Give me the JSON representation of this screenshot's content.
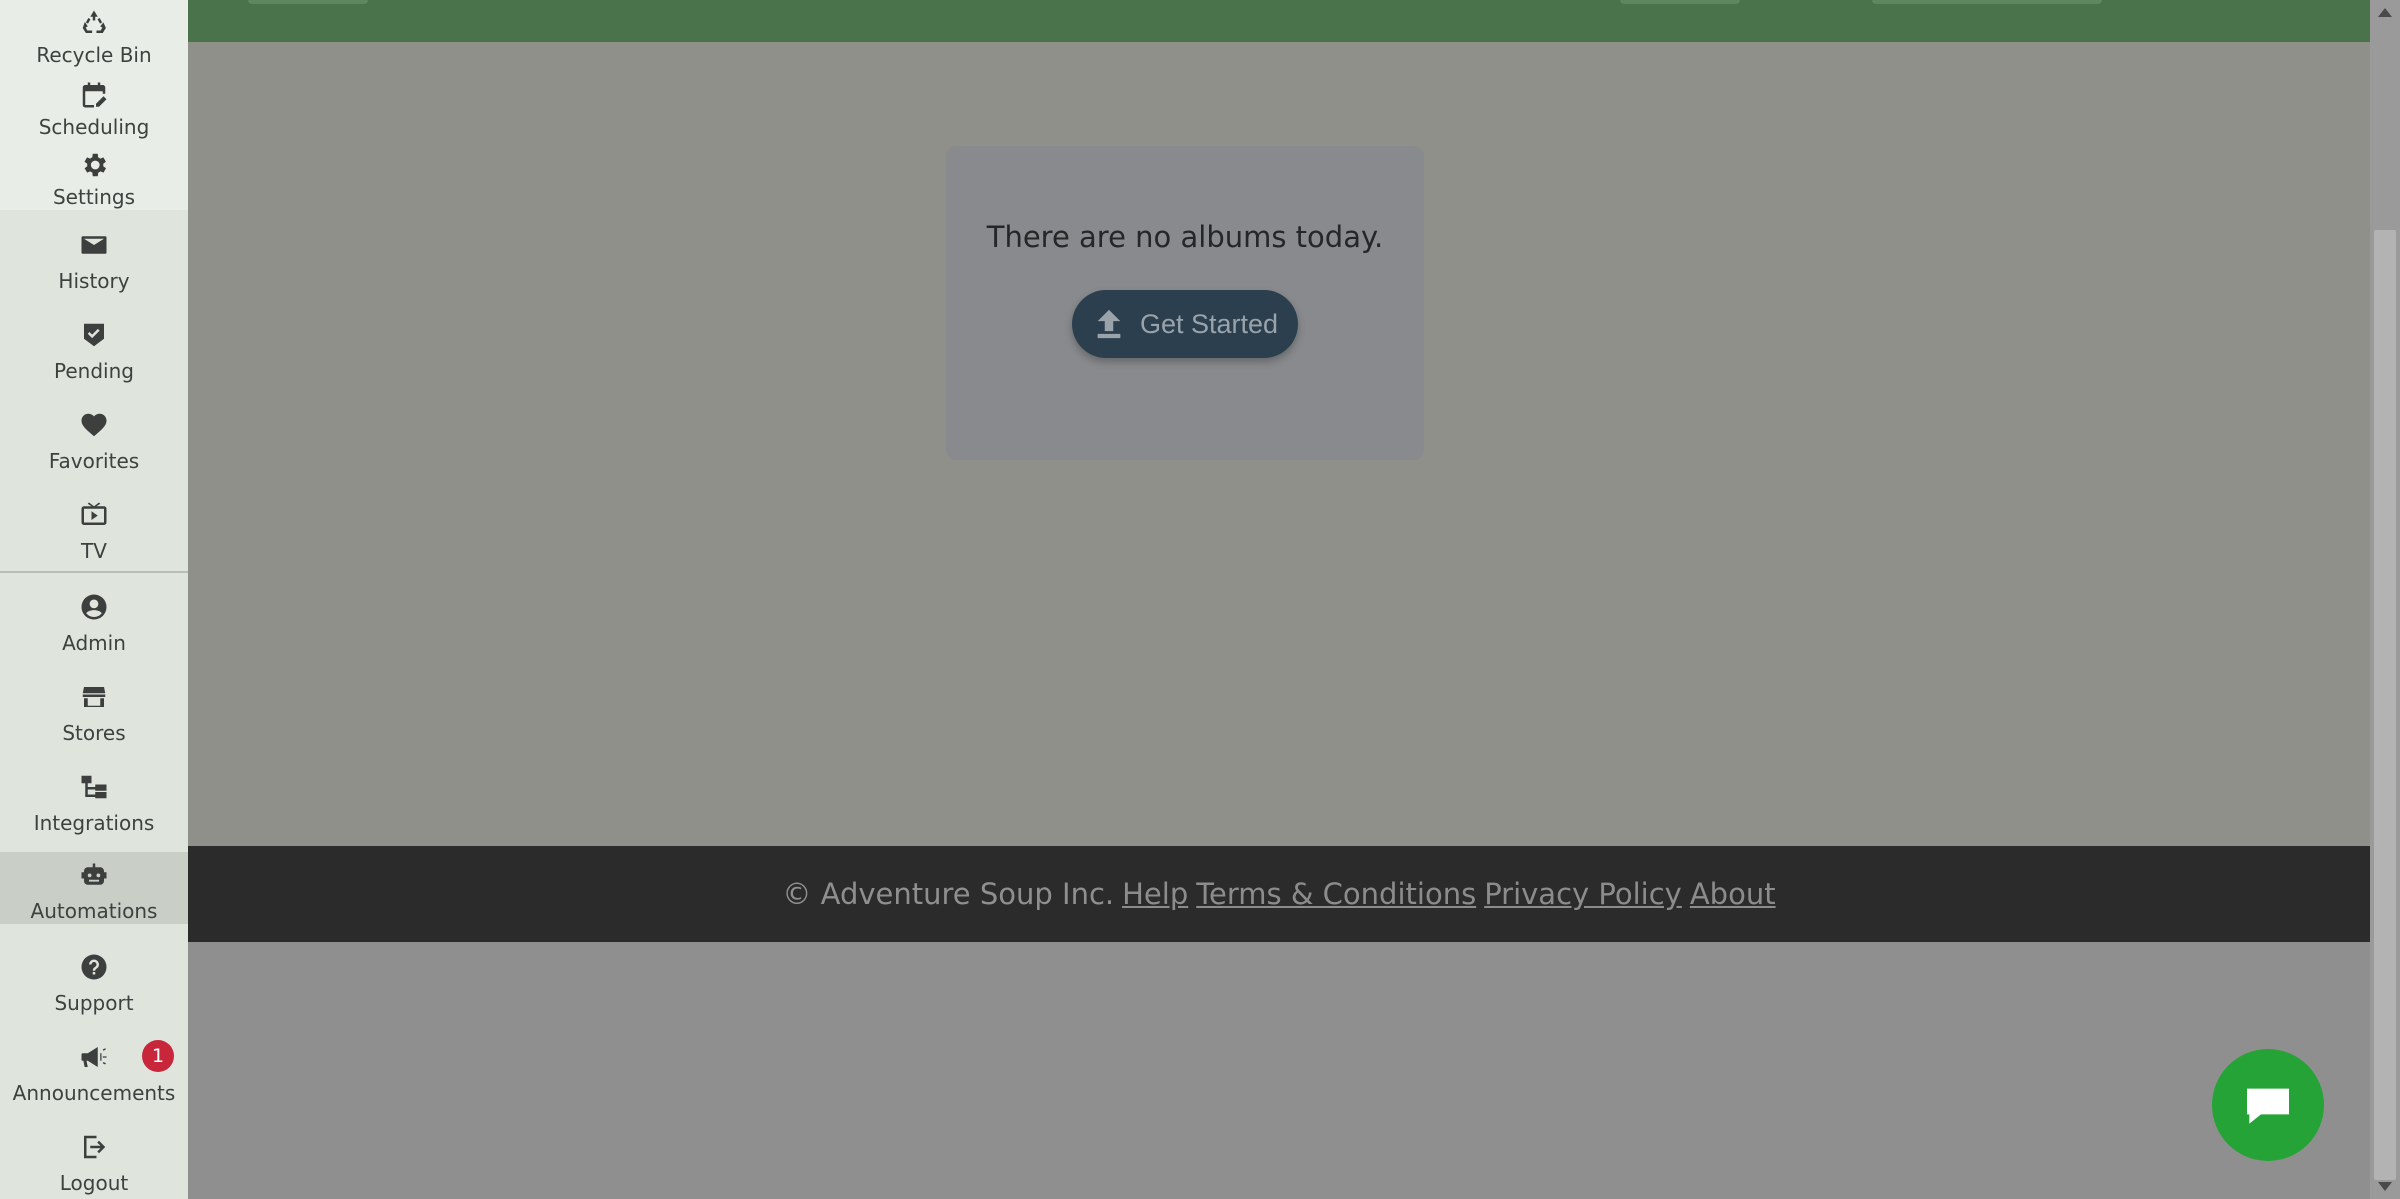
{
  "sidebar": {
    "items": [
      {
        "key": "recycle-bin",
        "label": "Recycle Bin",
        "icon": "recycle-icon"
      },
      {
        "key": "scheduling",
        "label": "Scheduling",
        "icon": "calendar-edit-icon"
      },
      {
        "key": "settings",
        "label": "Settings",
        "icon": "gear-icon"
      },
      {
        "key": "history",
        "label": "History",
        "icon": "envelope-icon"
      },
      {
        "key": "pending",
        "label": "Pending",
        "icon": "shield-check-icon"
      },
      {
        "key": "favorites",
        "label": "Favorites",
        "icon": "heart-icon"
      },
      {
        "key": "tv",
        "label": "TV",
        "icon": "tv-play-icon"
      },
      {
        "key": "admin",
        "label": "Admin",
        "icon": "user-circle-icon"
      },
      {
        "key": "stores",
        "label": "Stores",
        "icon": "store-icon"
      },
      {
        "key": "integrations",
        "label": "Integrations",
        "icon": "sitemap-icon"
      },
      {
        "key": "automations",
        "label": "Automations",
        "icon": "robot-icon",
        "active": true
      },
      {
        "key": "support",
        "label": "Support",
        "icon": "question-circle-icon"
      },
      {
        "key": "announcements",
        "label": "Announcements",
        "icon": "megaphone-icon",
        "badge": "1"
      },
      {
        "key": "logout",
        "label": "Logout",
        "icon": "sign-out-icon"
      }
    ]
  },
  "main": {
    "empty_message": "There are no albums today.",
    "get_started_label": "Get Started"
  },
  "footer": {
    "copyright": "© Adventure Soup Inc.",
    "links": [
      "Help",
      "Terms & Conditions",
      "Privacy Policy",
      "About"
    ]
  },
  "colors": {
    "topbar": "#4b734b",
    "footer_bg": "#2a2b2a",
    "chat_button": "#25a336",
    "get_started_bg": "#2b3f4f",
    "badge": "#c8273b"
  }
}
